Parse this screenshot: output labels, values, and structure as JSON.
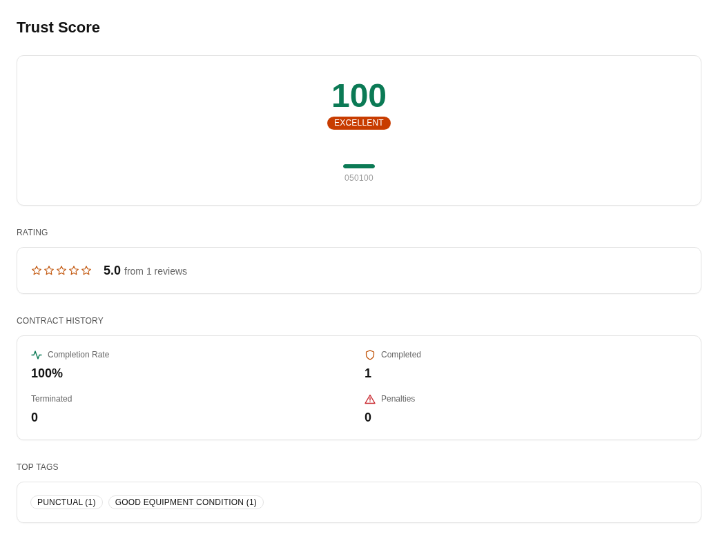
{
  "title": "Trust Score",
  "score": {
    "value": "100",
    "badge": "EXCELLENT",
    "gauge": {
      "level": 1,
      "scale_labels": "050100"
    }
  },
  "rating": {
    "heading": "RATING",
    "stars": 0,
    "value": "5.0",
    "reviews": "from 1 reviews"
  },
  "contract_history": {
    "heading": "CONTRACT HISTORY",
    "metrics": [
      {
        "kind": "rate",
        "label": "Completion Rate",
        "value": "100%"
      },
      {
        "kind": "completed",
        "label": "Completed",
        "value": "1"
      },
      {
        "kind": "plain",
        "label": "Terminated",
        "value": "0"
      },
      {
        "kind": "alert",
        "label": "Penalties",
        "value": "0"
      }
    ]
  },
  "top_tags": {
    "heading": "TOP TAGS",
    "tags": [
      "PUNCTUAL (1)",
      "GOOD EQUIPMENT CONDITION (1)"
    ]
  }
}
